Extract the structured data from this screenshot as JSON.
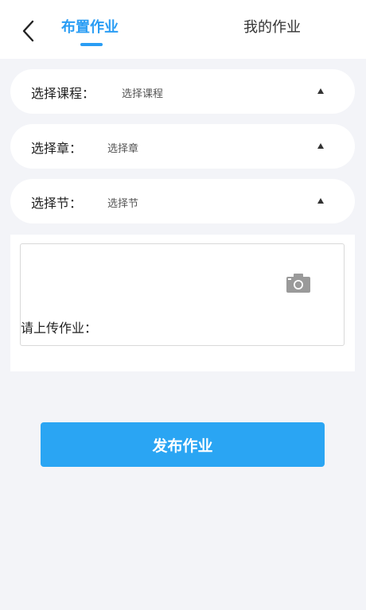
{
  "header": {
    "tabs": [
      {
        "label": "布置作业",
        "active": true
      },
      {
        "label": "我的作业",
        "active": false
      }
    ],
    "back_icon": "chevron-left-icon"
  },
  "form": {
    "course": {
      "label": "选择课程：",
      "value": "选择课程"
    },
    "chapter": {
      "label": "选择章：",
      "value": "选择章"
    },
    "section": {
      "label": "选择节：",
      "value": "选择节"
    },
    "dropdown_icon": "triangle-up-icon",
    "upload": {
      "label": "请上传作业：",
      "icon": "camera-icon"
    }
  },
  "actions": {
    "publish_label": "发布作业"
  },
  "colors": {
    "accent": "#2a9df4",
    "button": "#2aa5f3",
    "background": "#f3f4f8"
  }
}
